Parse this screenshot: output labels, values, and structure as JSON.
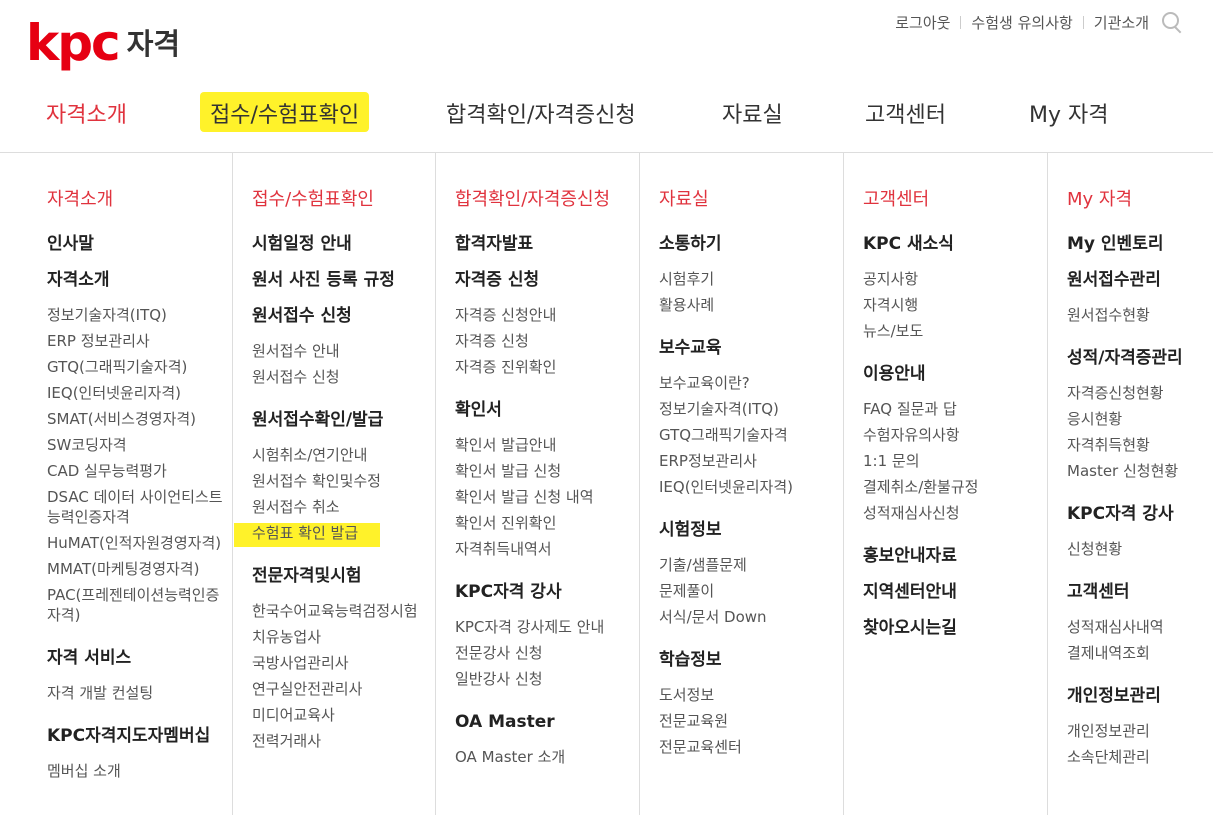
{
  "logo": {
    "text": "kpc",
    "suffix": "자격"
  },
  "utility": [
    {
      "label": "로그아웃"
    },
    {
      "label": "수험생 유의사항"
    },
    {
      "label": "기관소개"
    }
  ],
  "gnb": [
    {
      "label": "자격소개"
    },
    {
      "label": "접수/수험표확인"
    },
    {
      "label": "합격확인/자격증신청"
    },
    {
      "label": "자료실"
    },
    {
      "label": "고객센터"
    },
    {
      "label": "My 자격"
    }
  ],
  "columns": [
    {
      "title": "자격소개",
      "items": [
        {
          "t": "h",
          "label": "인사말"
        },
        {
          "t": "h",
          "label": "자격소개"
        },
        {
          "t": "s",
          "label": "정보기술자격(ITQ)"
        },
        {
          "t": "s",
          "label": "ERP 정보관리사"
        },
        {
          "t": "s",
          "label": "GTQ(그래픽기술자격)"
        },
        {
          "t": "s",
          "label": "IEQ(인터넷윤리자격)"
        },
        {
          "t": "s",
          "label": "SMAT(서비스경영자격)"
        },
        {
          "t": "s",
          "label": "SW코딩자격"
        },
        {
          "t": "s",
          "label": "CAD 실무능력평가"
        },
        {
          "t": "s",
          "label": "DSAC 데이터 사이언티스트 능력인증자격"
        },
        {
          "t": "s",
          "label": "HuMAT(인적자원경영자격)"
        },
        {
          "t": "s",
          "label": "MMAT(마케팅경영자격)"
        },
        {
          "t": "s",
          "label": "PAC(프레젠테이션능력인증자격)"
        },
        {
          "t": "h",
          "label": "자격 서비스"
        },
        {
          "t": "s",
          "label": "자격 개발 컨설팅"
        },
        {
          "t": "h",
          "label": "KPC자격지도자멤버십"
        },
        {
          "t": "s",
          "label": "멤버십 소개"
        }
      ]
    },
    {
      "title": "접수/수험표확인",
      "items": [
        {
          "t": "h",
          "label": "시험일정 안내"
        },
        {
          "t": "h",
          "label": "원서 사진 등록 규정"
        },
        {
          "t": "h",
          "label": "원서접수 신청"
        },
        {
          "t": "s",
          "label": "원서접수 안내"
        },
        {
          "t": "s",
          "label": "원서접수 신청"
        },
        {
          "t": "h",
          "label": "원서접수확인/발급"
        },
        {
          "t": "s",
          "label": "시험취소/연기안내"
        },
        {
          "t": "s",
          "label": "원서접수 확인및수정"
        },
        {
          "t": "s",
          "label": "원서접수 취소"
        },
        {
          "t": "s",
          "label": "수험표 확인 발급",
          "mark": true
        },
        {
          "t": "h",
          "label": "전문자격및시험"
        },
        {
          "t": "s",
          "label": "한국수어교육능력검정시험"
        },
        {
          "t": "s",
          "label": "치유농업사"
        },
        {
          "t": "s",
          "label": "국방사업관리사"
        },
        {
          "t": "s",
          "label": "연구실안전관리사"
        },
        {
          "t": "s",
          "label": "미디어교육사"
        },
        {
          "t": "s",
          "label": "전력거래사"
        }
      ]
    },
    {
      "title": "합격확인/자격증신청",
      "items": [
        {
          "t": "h",
          "label": "합격자발표"
        },
        {
          "t": "h",
          "label": "자격증 신청"
        },
        {
          "t": "s",
          "label": "자격증 신청안내"
        },
        {
          "t": "s",
          "label": "자격증 신청"
        },
        {
          "t": "s",
          "label": "자격증 진위확인"
        },
        {
          "t": "h",
          "label": "확인서"
        },
        {
          "t": "s",
          "label": "확인서 발급안내"
        },
        {
          "t": "s",
          "label": "확인서 발급 신청"
        },
        {
          "t": "s",
          "label": "확인서 발급 신청 내역"
        },
        {
          "t": "s",
          "label": "확인서 진위확인"
        },
        {
          "t": "s",
          "label": "자격취득내역서"
        },
        {
          "t": "h",
          "label": "KPC자격 강사"
        },
        {
          "t": "s",
          "label": "KPC자격 강사제도 안내"
        },
        {
          "t": "s",
          "label": "전문강사 신청"
        },
        {
          "t": "s",
          "label": "일반강사 신청"
        },
        {
          "t": "h",
          "label": "OA Master"
        },
        {
          "t": "s",
          "label": "OA Master 소개"
        }
      ]
    },
    {
      "title": "자료실",
      "items": [
        {
          "t": "h",
          "label": "소통하기"
        },
        {
          "t": "s",
          "label": "시험후기"
        },
        {
          "t": "s",
          "label": "활용사례"
        },
        {
          "t": "h",
          "label": "보수교육"
        },
        {
          "t": "s",
          "label": "보수교육이란?"
        },
        {
          "t": "s",
          "label": "정보기술자격(ITQ)"
        },
        {
          "t": "s",
          "label": "GTQ그래픽기술자격"
        },
        {
          "t": "s",
          "label": "ERP정보관리사"
        },
        {
          "t": "s",
          "label": "IEQ(인터넷윤리자격)"
        },
        {
          "t": "h",
          "label": "시험정보"
        },
        {
          "t": "s",
          "label": "기출/샘플문제"
        },
        {
          "t": "s",
          "label": "문제풀이"
        },
        {
          "t": "s",
          "label": "서식/문서 Down"
        },
        {
          "t": "h",
          "label": "학습정보"
        },
        {
          "t": "s",
          "label": "도서정보"
        },
        {
          "t": "s",
          "label": "전문교육원"
        },
        {
          "t": "s",
          "label": "전문교육센터"
        }
      ]
    },
    {
      "title": "고객센터",
      "items": [
        {
          "t": "h",
          "label": "KPC 새소식"
        },
        {
          "t": "s",
          "label": "공지사항"
        },
        {
          "t": "s",
          "label": "자격시행"
        },
        {
          "t": "s",
          "label": "뉴스/보도"
        },
        {
          "t": "h",
          "label": "이용안내"
        },
        {
          "t": "s",
          "label": "FAQ 질문과 답"
        },
        {
          "t": "s",
          "label": "수험자유의사항"
        },
        {
          "t": "s",
          "label": "1:1 문의"
        },
        {
          "t": "s",
          "label": "결제취소/환불규정"
        },
        {
          "t": "s",
          "label": "성적재심사신청"
        },
        {
          "t": "h",
          "label": "홍보안내자료"
        },
        {
          "t": "h",
          "label": "지역센터안내"
        },
        {
          "t": "h",
          "label": "찾아오시는길"
        }
      ]
    },
    {
      "title": "My 자격",
      "items": [
        {
          "t": "h",
          "label": "My 인벤토리"
        },
        {
          "t": "h",
          "label": "원서접수관리"
        },
        {
          "t": "s",
          "label": "원서접수현황"
        },
        {
          "t": "h",
          "label": "성적/자격증관리"
        },
        {
          "t": "s",
          "label": "자격증신청현황"
        },
        {
          "t": "s",
          "label": "응시현황"
        },
        {
          "t": "s",
          "label": "자격취득현황"
        },
        {
          "t": "s",
          "label": "Master 신청현황"
        },
        {
          "t": "h",
          "label": "KPC자격 강사"
        },
        {
          "t": "s",
          "label": "신청현황"
        },
        {
          "t": "h",
          "label": "고객센터"
        },
        {
          "t": "s",
          "label": "성적재심사내역"
        },
        {
          "t": "s",
          "label": "결제내역조회"
        },
        {
          "t": "h",
          "label": "개인정보관리"
        },
        {
          "t": "s",
          "label": "개인정보관리"
        },
        {
          "t": "s",
          "label": "소속단체관리"
        }
      ]
    }
  ],
  "colors": {
    "accent": "#e0333e",
    "highlight": "#fff22a",
    "logo": "#e60012"
  }
}
